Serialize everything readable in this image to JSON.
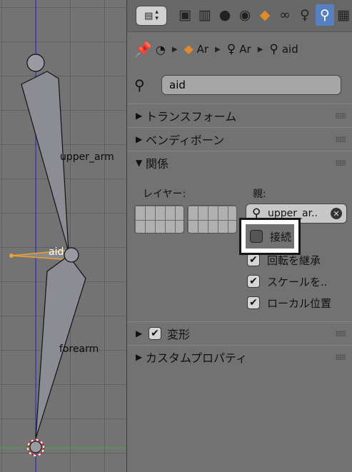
{
  "viewport": {
    "bone_labels": {
      "upper_arm": "upper_arm",
      "aid": "aid",
      "forearm": "forearm"
    }
  },
  "header": {
    "editor_type_icon": "properties-editor-icon",
    "context_buttons": [
      {
        "name": "render",
        "icon": "camera-icon"
      },
      {
        "name": "render-layers",
        "icon": "render-layers-icon"
      },
      {
        "name": "scene",
        "icon": "scene-icon"
      },
      {
        "name": "world",
        "icon": "world-icon"
      },
      {
        "name": "object",
        "icon": "cube-icon"
      },
      {
        "name": "constraints",
        "icon": "chain-link-icon"
      },
      {
        "name": "armature",
        "icon": "armature-figure-icon"
      },
      {
        "name": "bone",
        "icon": "bone-icon",
        "active": true
      },
      {
        "name": "bone-constraints",
        "icon": "checker-icon"
      }
    ],
    "accent_color": "#5680c2"
  },
  "breadcrumb": {
    "items": [
      "Ar",
      "Ar",
      "aid"
    ]
  },
  "bone_name": {
    "value": "aid"
  },
  "sections": {
    "transform": {
      "label": "トランスフォーム",
      "open": false
    },
    "bendy_bones": {
      "label": "ベンディボーン",
      "open": false
    },
    "relations": {
      "label": "関係",
      "open": true
    },
    "deform": {
      "label": "変形",
      "open": false,
      "checked": true
    },
    "custom_props": {
      "label": "カスタムプロパティ",
      "open": false
    }
  },
  "relations": {
    "layers_label": "レイヤー:",
    "parent_label": "親:",
    "parent_value": "upper_ar..",
    "connect": {
      "label": "接続",
      "checked": false
    },
    "inherit_rotation": {
      "label": "回転を継承",
      "checked": true
    },
    "scale": {
      "label": "スケールを..",
      "checked": true
    },
    "local_location": {
      "label": "ローカル位置",
      "checked": true
    }
  }
}
